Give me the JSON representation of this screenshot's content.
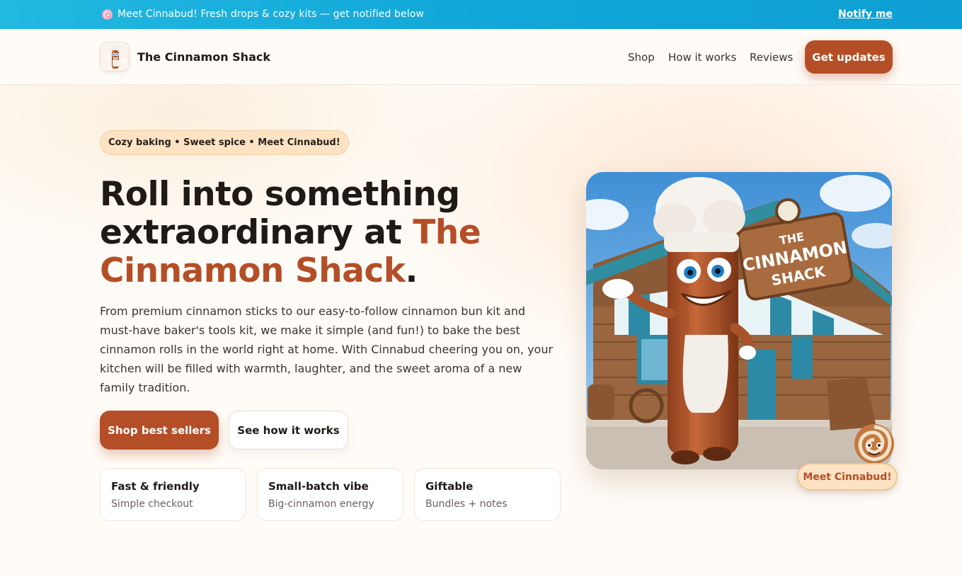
{
  "announcement": {
    "text": "Meet Cinnabud! Fresh drops & cozy kits — get notified below",
    "link": "Notify me",
    "icon": "cinnamon-roll-icon"
  },
  "header": {
    "brand": "The Cinnamon Shack",
    "logo": "cinnabud-mascot-logo",
    "nav": [
      "Shop",
      "How it works",
      "Reviews"
    ],
    "cta": "Get updates"
  },
  "hero": {
    "pill": "Cozy baking • Sweet spice • Meet Cinnabud!",
    "headline_part1": "Roll into something extraordinary at ",
    "headline_accent": "The Cinnamon Shack",
    "headline_end": ".",
    "lede": "From premium cinnamon sticks to our easy-to-follow cinnamon bun kit and must-have baker's tools kit, we make it simple (and fun!) to bake the best cinnamon rolls in the world right at home. With Cinnabud cheering you on, your kitchen will be filled with warmth, laughter, and the sweet aroma of a new family tradition.",
    "primary_cta": "Shop best sellers",
    "secondary_cta": "See how it works",
    "features": [
      {
        "title": "Fast & friendly",
        "subtitle": "Simple checkout"
      },
      {
        "title": "Small-batch vibe",
        "subtitle": "Big-cinnamon energy"
      },
      {
        "title": "Giftable",
        "subtitle": "Bundles + notes"
      }
    ],
    "illustration": {
      "sign_line1": "THE",
      "sign_line2": "CINNAMON",
      "sign_line3": "SHACK"
    },
    "meet_button": "Meet Cinnabud!"
  },
  "colors": {
    "accent": "#b44e27",
    "announce_bg": "#12a7d8",
    "pill_bg": "#fde3c4",
    "page_bg": "#fffcf7"
  }
}
